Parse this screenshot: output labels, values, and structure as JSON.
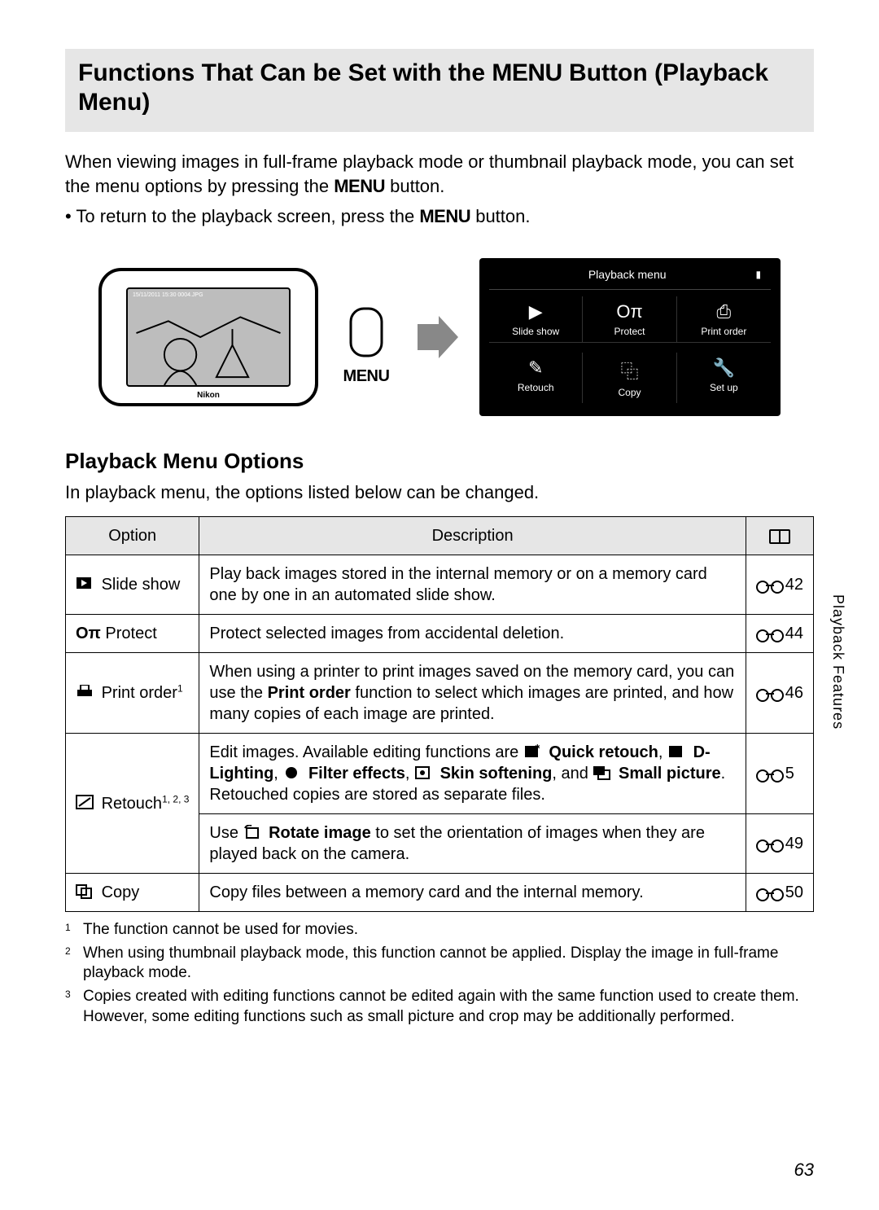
{
  "page_number": "63",
  "side_tab": "Playback Features",
  "h1_pre": "Functions That Can be Set with the ",
  "h1_menu": "MENU",
  "h1_post": " Button (Playback Menu)",
  "intro_line1": "When viewing images in full-frame playback mode or thumbnail playback mode, you can set the menu options by pressing the ",
  "intro_line1_post": " button.",
  "bullet1_pre": "To return to the playback screen, press the ",
  "bullet1_post": " button.",
  "menu_button_label": "MENU",
  "camera_top_text": "15/11/2011 15:30\n0004.JPG",
  "camera_brand": "Nikon",
  "menu_panel": {
    "title": "Playback menu",
    "items": [
      {
        "icon": "▶",
        "label": "Slide show"
      },
      {
        "icon": "Oπ",
        "label": "Protect"
      },
      {
        "icon": "⎙",
        "label": "Print order"
      },
      {
        "icon": "✎",
        "label": "Retouch"
      },
      {
        "icon": "⿻",
        "label": "Copy"
      },
      {
        "icon": "🔧",
        "label": "Set up"
      }
    ]
  },
  "h2": "Playback Menu Options",
  "lead": "In playback menu, the options listed below can be changed.",
  "table": {
    "head": {
      "option": "Option",
      "description": "Description"
    },
    "rows": [
      {
        "icon": "slideshow-icon",
        "option": "Slide show",
        "sup": "",
        "description": "Play back images stored in the internal memory or on a memory card one by one in an automated slide show.",
        "ref": "42"
      },
      {
        "icon": "protect-icon",
        "option_pre": "O",
        "option": " Protect",
        "sup": "",
        "description": "Protect selected images from accidental deletion.",
        "ref": "44"
      },
      {
        "icon": "print-order-icon",
        "option": "Print order",
        "sup": "1",
        "desc_pre": "When using a printer to print images saved on the memory card, you can use the ",
        "desc_bold": "Print order",
        "desc_post": " function to select which images are printed, and how many copies of each image are printed.",
        "ref": "46"
      },
      {
        "icon": "retouch-icon",
        "option": "Retouch",
        "sup": "1, 2, 3",
        "retouch_text": {
          "t1": "Edit images. Available editing functions are ",
          "b1": "Quick retouch",
          "t2": ", ",
          "b2": "D-Lighting",
          "t3": ", ",
          "b3": "Filter effects",
          "t4": ", ",
          "b4": "Skin softening",
          "t5": ", and ",
          "b5": "Small picture",
          "t6": ". Retouched copies are stored as separate files."
        },
        "ref": "5"
      },
      {
        "rotate_text": {
          "t1": "Use ",
          "b1": "Rotate image",
          "t2": " to set the orientation of images when they are played back on the camera."
        },
        "ref": "49"
      },
      {
        "icon": "copy-icon",
        "option": "Copy",
        "sup": "",
        "description": "Copy files between a memory card and the internal memory.",
        "ref": "50"
      }
    ]
  },
  "footnotes": [
    "The function cannot be used for movies.",
    "When using thumbnail playback mode, this function cannot be applied. Display the image in full-frame playback mode.",
    "Copies created with editing functions cannot be edited again with the same function used to create them. However, some editing functions such as small picture and crop may be additionally performed."
  ]
}
